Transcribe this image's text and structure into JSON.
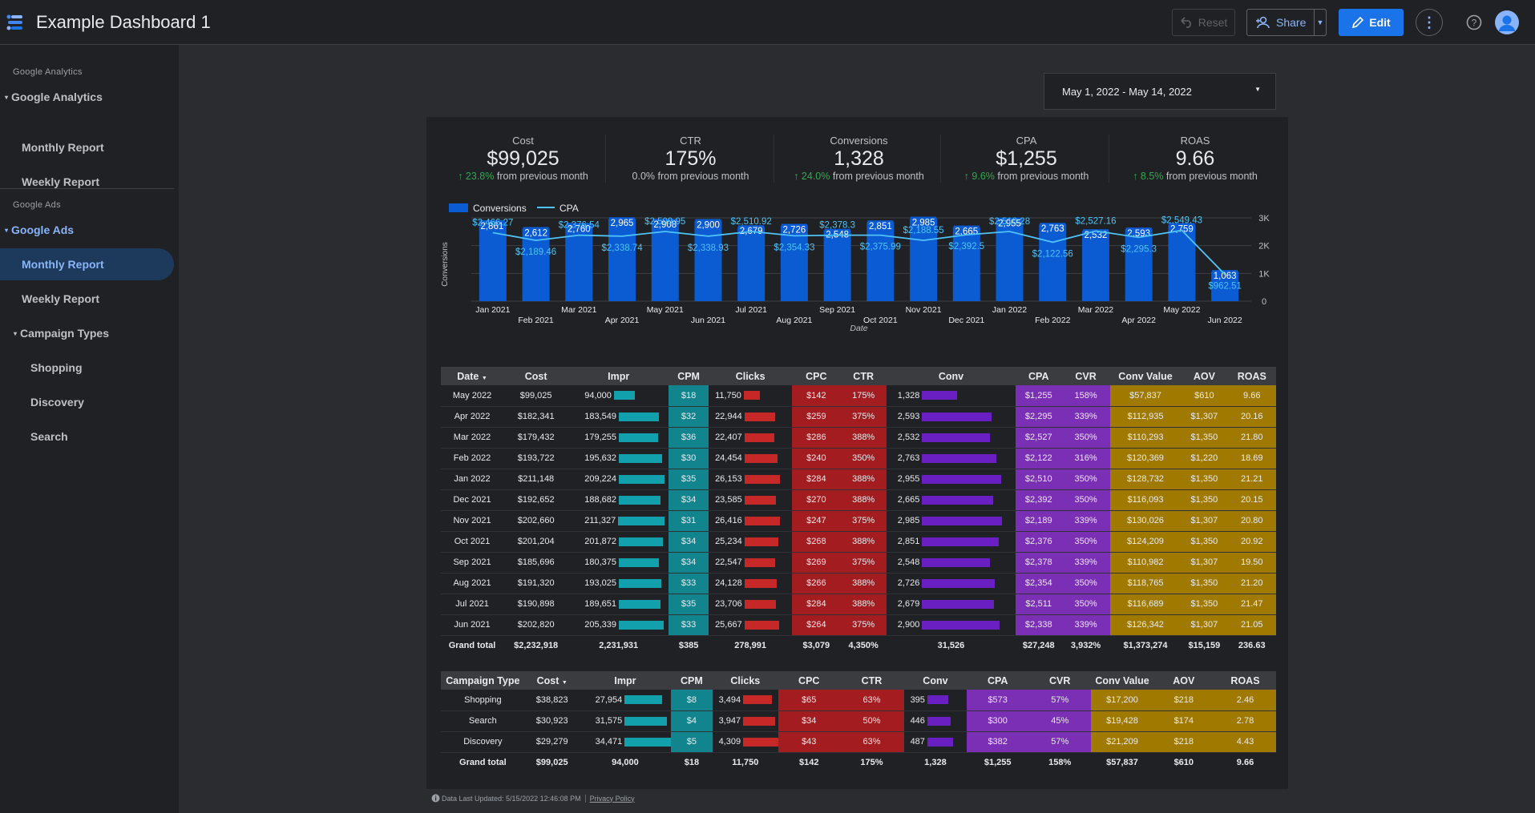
{
  "header": {
    "title": "Example Dashboard 1",
    "reset_label": "Reset",
    "share_label": "Share",
    "edit_label": "Edit"
  },
  "sidebar": {
    "sections": [
      {
        "section_label": "Google Analytics",
        "group_label": "Google Analytics",
        "items": [
          "Monthly Report",
          "Weekly Report"
        ]
      },
      {
        "section_label": "Google Ads",
        "group_label": "Google Ads",
        "items": [
          "Monthly Report",
          "Weekly Report"
        ],
        "subgroup_label": "Campaign Types",
        "subitems": [
          "Shopping",
          "Discovery",
          "Search"
        ]
      }
    ],
    "selected": "Google Ads / Monthly Report"
  },
  "date_range": "May 1, 2022 - May 14, 2022",
  "kpis": [
    {
      "label": "Cost",
      "value": "$99,025",
      "change": "23.8%",
      "suffix": "from previous month",
      "up": true
    },
    {
      "label": "CTR",
      "value": "175%",
      "change": "0.0%",
      "suffix": "from previous month",
      "up": false
    },
    {
      "label": "Conversions",
      "value": "1,328",
      "change": "24.0%",
      "suffix": "from previous month",
      "up": true
    },
    {
      "label": "CPA",
      "value": "$1,255",
      "change": "9.6%",
      "suffix": "from previous month",
      "up": true
    },
    {
      "label": "ROAS",
      "value": "9.66",
      "change": "8.5%",
      "suffix": "from previous month",
      "up": true
    }
  ],
  "colors": {
    "bar": "#0b5bd3",
    "line": "#4fc3f7",
    "accent": "#1a73e8",
    "cpm": "#12848e",
    "cpc": "#a31d20",
    "cpa": "#7b2fb5",
    "gold": "#a07a00"
  },
  "chart_data": {
    "type": "bar",
    "categories": [
      "Jan 2021",
      "Feb 2021",
      "Mar 2021",
      "Apr 2021",
      "May 2021",
      "Jun 2021",
      "Jul 2021",
      "Aug 2021",
      "Sep 2021",
      "Oct 2021",
      "Nov 2021",
      "Dec 2021",
      "Jan 2022",
      "Feb 2022",
      "Mar 2022",
      "Apr 2022",
      "May 2022",
      "Jun 2022"
    ],
    "series": [
      {
        "name": "Conversions",
        "type": "bar",
        "axis": "left",
        "values": [
          2861,
          2612,
          2760,
          2965,
          2908,
          2900,
          2679,
          2726,
          2548,
          2851,
          2985,
          2665,
          2955,
          2763,
          2532,
          2593,
          2759,
          1063
        ],
        "labels": [
          "2,861",
          "2,612",
          "2,760",
          "2,965",
          "2,908",
          "2,900",
          "2,679",
          "2,726",
          "2,548",
          "2,851",
          "2,985",
          "2,665",
          "2,955",
          "2,763",
          "2,532",
          "2,593",
          "2,759",
          "1,063"
        ]
      },
      {
        "name": "CPA",
        "type": "line",
        "axis": "right",
        "values": [
          2466.27,
          2189.46,
          2376.54,
          2338.74,
          2509.95,
          2338.93,
          2510.92,
          2354.33,
          2378.3,
          2375.99,
          2188.55,
          2392.5,
          2510.28,
          2122.56,
          2527.16,
          2295.3,
          2549.43,
          962.51
        ],
        "labels": [
          "$2,466.27",
          "$2,189.46",
          "$2,376.54",
          "$2,338.74",
          "$2,509.95",
          "$2,338.93",
          "$2,510.92",
          "$2,354.33",
          "$2,378.3",
          "$2,375.99",
          "$2,188.55",
          "$2,392.5",
          "$2,510.28",
          "$2,122.56",
          "$2,527.16",
          "$2,295.3",
          "$2,549.43",
          "$962.51"
        ]
      }
    ],
    "xlabel": "Date",
    "ylabel": "Conversions",
    "y_ticks": [
      "0",
      "1K",
      "2K",
      "3K"
    ],
    "ylim": [
      0,
      3000
    ],
    "legend": "top-left",
    "grid": true
  },
  "monthly_table": {
    "headers": [
      "Date",
      "Cost",
      "Impr",
      "CPM",
      "Clicks",
      "CPC",
      "CTR",
      "Conv",
      "CPA",
      "CVR",
      "Conv Value",
      "AOV",
      "ROAS"
    ],
    "rows": [
      {
        "date": "May 2022",
        "cost": "$99,025",
        "impr": "94,000",
        "impr_n": 94000,
        "cpm": "$18",
        "clicks": "11,750",
        "clicks_n": 11750,
        "cpc": "$142",
        "ctr": "175%",
        "conv": "1,328",
        "conv_n": 1328,
        "cpa": "$1,255",
        "cvr": "158%",
        "conv_value": "$57,837",
        "aov": "$610",
        "roas": "9.66"
      },
      {
        "date": "Apr 2022",
        "cost": "$182,341",
        "impr": "183,549",
        "impr_n": 183549,
        "cpm": "$32",
        "clicks": "22,944",
        "clicks_n": 22944,
        "cpc": "$259",
        "ctr": "375%",
        "conv": "2,593",
        "conv_n": 2593,
        "cpa": "$2,295",
        "cvr": "339%",
        "conv_value": "$112,935",
        "aov": "$1,307",
        "roas": "20.16"
      },
      {
        "date": "Mar 2022",
        "cost": "$179,432",
        "impr": "179,255",
        "impr_n": 179255,
        "cpm": "$36",
        "clicks": "22,407",
        "clicks_n": 22407,
        "cpc": "$286",
        "ctr": "388%",
        "conv": "2,532",
        "conv_n": 2532,
        "cpa": "$2,527",
        "cvr": "350%",
        "conv_value": "$110,293",
        "aov": "$1,350",
        "roas": "21.80"
      },
      {
        "date": "Feb 2022",
        "cost": "$193,722",
        "impr": "195,632",
        "impr_n": 195632,
        "cpm": "$30",
        "clicks": "24,454",
        "clicks_n": 24454,
        "cpc": "$240",
        "ctr": "350%",
        "conv": "2,763",
        "conv_n": 2763,
        "cpa": "$2,122",
        "cvr": "316%",
        "conv_value": "$120,369",
        "aov": "$1,220",
        "roas": "18.69"
      },
      {
        "date": "Jan 2022",
        "cost": "$211,148",
        "impr": "209,224",
        "impr_n": 209224,
        "cpm": "$35",
        "clicks": "26,153",
        "clicks_n": 26153,
        "cpc": "$284",
        "ctr": "388%",
        "conv": "2,955",
        "conv_n": 2955,
        "cpa": "$2,510",
        "cvr": "350%",
        "conv_value": "$128,732",
        "aov": "$1,350",
        "roas": "21.21"
      },
      {
        "date": "Dec 2021",
        "cost": "$192,652",
        "impr": "188,682",
        "impr_n": 188682,
        "cpm": "$34",
        "clicks": "23,585",
        "clicks_n": 23585,
        "cpc": "$270",
        "ctr": "388%",
        "conv": "2,665",
        "conv_n": 2665,
        "cpa": "$2,392",
        "cvr": "350%",
        "conv_value": "$116,093",
        "aov": "$1,350",
        "roas": "20.15"
      },
      {
        "date": "Nov 2021",
        "cost": "$202,660",
        "impr": "211,327",
        "impr_n": 211327,
        "cpm": "$31",
        "clicks": "26,416",
        "clicks_n": 26416,
        "cpc": "$247",
        "ctr": "375%",
        "conv": "2,985",
        "conv_n": 2985,
        "cpa": "$2,189",
        "cvr": "339%",
        "conv_value": "$130,026",
        "aov": "$1,307",
        "roas": "20.80"
      },
      {
        "date": "Oct 2021",
        "cost": "$201,204",
        "impr": "201,872",
        "impr_n": 201872,
        "cpm": "$34",
        "clicks": "25,234",
        "clicks_n": 25234,
        "cpc": "$268",
        "ctr": "388%",
        "conv": "2,851",
        "conv_n": 2851,
        "cpa": "$2,376",
        "cvr": "350%",
        "conv_value": "$124,209",
        "aov": "$1,350",
        "roas": "20.92"
      },
      {
        "date": "Sep 2021",
        "cost": "$185,696",
        "impr": "180,375",
        "impr_n": 180375,
        "cpm": "$34",
        "clicks": "22,547",
        "clicks_n": 22547,
        "cpc": "$269",
        "ctr": "375%",
        "conv": "2,548",
        "conv_n": 2548,
        "cpa": "$2,378",
        "cvr": "339%",
        "conv_value": "$110,982",
        "aov": "$1,307",
        "roas": "19.50"
      },
      {
        "date": "Aug 2021",
        "cost": "$191,320",
        "impr": "193,025",
        "impr_n": 193025,
        "cpm": "$33",
        "clicks": "24,128",
        "clicks_n": 24128,
        "cpc": "$266",
        "ctr": "388%",
        "conv": "2,726",
        "conv_n": 2726,
        "cpa": "$2,354",
        "cvr": "350%",
        "conv_value": "$118,765",
        "aov": "$1,350",
        "roas": "21.20"
      },
      {
        "date": "Jul 2021",
        "cost": "$190,898",
        "impr": "189,651",
        "impr_n": 189651,
        "cpm": "$35",
        "clicks": "23,706",
        "clicks_n": 23706,
        "cpc": "$284",
        "ctr": "388%",
        "conv": "2,679",
        "conv_n": 2679,
        "cpa": "$2,511",
        "cvr": "350%",
        "conv_value": "$116,689",
        "aov": "$1,350",
        "roas": "21.47"
      },
      {
        "date": "Jun 2021",
        "cost": "$202,820",
        "impr": "205,339",
        "impr_n": 205339,
        "cpm": "$33",
        "clicks": "25,667",
        "clicks_n": 25667,
        "cpc": "$264",
        "ctr": "375%",
        "conv": "2,900",
        "conv_n": 2900,
        "cpa": "$2,338",
        "cvr": "339%",
        "conv_value": "$126,342",
        "aov": "$1,307",
        "roas": "21.05"
      }
    ],
    "total": {
      "date": "Grand total",
      "cost": "$2,232,918",
      "impr": "2,231,931",
      "cpm": "$385",
      "clicks": "278,991",
      "cpc": "$3,079",
      "ctr": "4,350%",
      "conv": "31,526",
      "cpa": "$27,248",
      "cvr": "3,932%",
      "conv_value": "$1,373,274",
      "aov": "$15,159",
      "roas": "236.63"
    }
  },
  "campaign_table": {
    "headers": [
      "Campaign Type",
      "Cost",
      "Impr",
      "CPM",
      "Clicks",
      "CPC",
      "CTR",
      "Conv",
      "CPA",
      "CVR",
      "Conv Value",
      "AOV",
      "ROAS"
    ],
    "rows": [
      {
        "date": "Shopping",
        "cost": "$38,823",
        "impr": "27,954",
        "impr_n": 27954,
        "cpm": "$8",
        "clicks": "3,494",
        "clicks_n": 3494,
        "cpc": "$65",
        "ctr": "63%",
        "conv": "395",
        "conv_n": 395,
        "cpa": "$573",
        "cvr": "57%",
        "conv_value": "$17,200",
        "aov": "$218",
        "roas": "2.46"
      },
      {
        "date": "Search",
        "cost": "$30,923",
        "impr": "31,575",
        "impr_n": 31575,
        "cpm": "$4",
        "clicks": "3,947",
        "clicks_n": 3947,
        "cpc": "$34",
        "ctr": "50%",
        "conv": "446",
        "conv_n": 446,
        "cpa": "$300",
        "cvr": "45%",
        "conv_value": "$19,428",
        "aov": "$174",
        "roas": "2.78"
      },
      {
        "date": "Discovery",
        "cost": "$29,279",
        "impr": "34,471",
        "impr_n": 34471,
        "cpm": "$5",
        "clicks": "4,309",
        "clicks_n": 4309,
        "cpc": "$43",
        "ctr": "63%",
        "conv": "487",
        "conv_n": 487,
        "cpa": "$382",
        "cvr": "57%",
        "conv_value": "$21,209",
        "aov": "$218",
        "roas": "4.43"
      }
    ],
    "total": {
      "date": "Grand total",
      "cost": "$99,025",
      "impr": "94,000",
      "cpm": "$18",
      "clicks": "11,750",
      "cpc": "$142",
      "ctr": "175%",
      "conv": "1,328",
      "cpa": "$1,255",
      "cvr": "158%",
      "conv_value": "$57,837",
      "aov": "$610",
      "roas": "9.66"
    }
  },
  "footer": {
    "updated": "Data Last Updated: 5/15/2022 12:46:08 PM",
    "privacy": "Privacy Policy"
  }
}
